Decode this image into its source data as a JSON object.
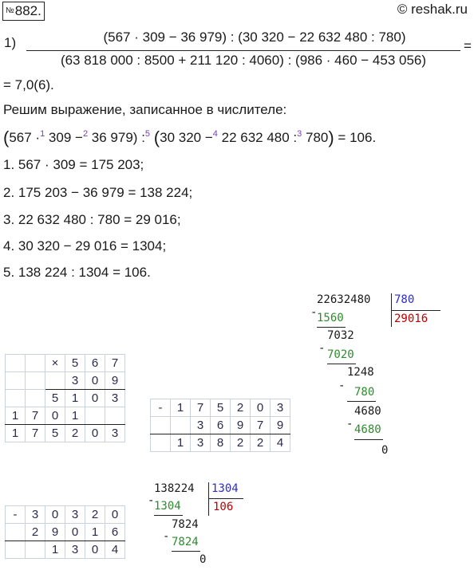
{
  "header": {
    "badge_prefix": "№",
    "badge_number": "882.",
    "site": "© reshak.ru"
  },
  "expression": {
    "item": "1)",
    "numerator": "(567 · 309 − 36 979) : (30 320 − 22 632 480 : 780)",
    "denominator": "(63 818 000 : 8500 + 211 120 : 4060) : (986 · 460 − 453 056)",
    "equals": "=",
    "result": "= 7,0(6)."
  },
  "intro": "Решим выражение, записанное в числителе:",
  "order_line": {
    "p1": "567 ·",
    "s1": "1",
    "p2": " 309 −",
    "s2": "2",
    "p3": " 36 979)",
    "p4": " :",
    "s5": "5",
    "p5": "30 320 −",
    "s4": "4",
    "p6": " 22 632 480 :",
    "s3": "3",
    "p7": " 780",
    "p8": " = 106.",
    "lparen": "(",
    "rparen": ")"
  },
  "steps": [
    "1.  567 · 309 = 175 203;",
    "2.  175 203 − 36 979 = 138 224;",
    "3.  22 632 480 : 780 = 29 016;",
    "4.  30 320 − 29 016 = 1304;",
    "5.  138 224 : 1304 = 106."
  ],
  "mult_grid": [
    [
      "",
      "",
      "×",
      "5",
      "6",
      "7"
    ],
    [
      "",
      "",
      "",
      "3",
      "0",
      "9"
    ],
    [
      "",
      "",
      "5",
      "1",
      "0",
      "3"
    ],
    [
      "1",
      "7",
      "0",
      "1",
      "",
      ""
    ],
    [
      "1",
      "7",
      "5",
      "2",
      "0",
      "3"
    ]
  ],
  "sub_grid_1": [
    [
      "-",
      "1",
      "7",
      "5",
      "2",
      "0",
      "3"
    ],
    [
      "",
      "",
      "3",
      "6",
      "9",
      "7",
      "9"
    ],
    [
      "",
      "1",
      "3",
      "8",
      "2",
      "2",
      "4"
    ]
  ],
  "sub_grid_2": [
    [
      "-",
      "3",
      "0",
      "3",
      "2",
      "0"
    ],
    [
      "",
      "2",
      "9",
      "0",
      "1",
      "6"
    ],
    [
      "",
      "",
      "1",
      "3",
      "0",
      "4"
    ]
  ],
  "long_div_1": {
    "dividend": "22632480",
    "divisor": "780",
    "quotient": "29016",
    "rows": [
      "1560",
      "7032",
      "7020",
      "1248",
      "780",
      "4680",
      "4680",
      "0"
    ]
  },
  "long_div_2": {
    "dividend": "138224",
    "divisor": "1304",
    "quotient": "106",
    "rows": [
      "1304",
      "7824",
      "7824",
      "0"
    ]
  },
  "colors": {
    "divisor": "#2b2bd0",
    "quotient": "#c00000",
    "subtrahend": "#2e8b2e",
    "order_marks": "#7a3db8"
  }
}
